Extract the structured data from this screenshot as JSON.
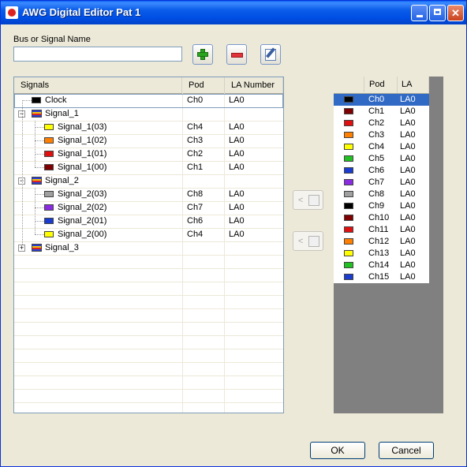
{
  "window": {
    "title": "AWG Digital Editor Pat 1",
    "min": "_",
    "max": "□",
    "close": "✕"
  },
  "form": {
    "bus_label": "Bus or Signal Name",
    "bus_value": "",
    "add_icon": "plus-icon",
    "remove_icon": "minus-icon",
    "edit_icon": "edit-icon"
  },
  "signals_table": {
    "headers": {
      "signals": "Signals",
      "pod": "Pod",
      "la": "LA Number"
    },
    "rows": [
      {
        "kind": "signal",
        "level": 0,
        "name": "Clock",
        "pod": "Ch0",
        "la": "LA0",
        "color": "#000000",
        "selected": true
      },
      {
        "kind": "bus",
        "level": 0,
        "expander": "−",
        "name": "Signal_1",
        "pod": "",
        "la": ""
      },
      {
        "kind": "signal",
        "level": 1,
        "name": "Signal_1(03)",
        "pod": "Ch4",
        "la": "LA0",
        "color": "#ffff00"
      },
      {
        "kind": "signal",
        "level": 1,
        "name": "Signal_1(02)",
        "pod": "Ch3",
        "la": "LA0",
        "color": "#ff7f00"
      },
      {
        "kind": "signal",
        "level": 1,
        "name": "Signal_1(01)",
        "pod": "Ch2",
        "la": "LA0",
        "color": "#e01010"
      },
      {
        "kind": "signal",
        "level": 1,
        "name": "Signal_1(00)",
        "pod": "Ch1",
        "la": "LA0",
        "color": "#7f0000"
      },
      {
        "kind": "bus",
        "level": 0,
        "expander": "−",
        "name": "Signal_2",
        "pod": "",
        "la": ""
      },
      {
        "kind": "signal",
        "level": 1,
        "name": "Signal_2(03)",
        "pod": "Ch8",
        "la": "LA0",
        "color": "#a0a0a0"
      },
      {
        "kind": "signal",
        "level": 1,
        "name": "Signal_2(02)",
        "pod": "Ch7",
        "la": "LA0",
        "color": "#8a2be2"
      },
      {
        "kind": "signal",
        "level": 1,
        "name": "Signal_2(01)",
        "pod": "Ch6",
        "la": "LA0",
        "color": "#1a3ccf"
      },
      {
        "kind": "signal",
        "level": 1,
        "name": "Signal_2(00)",
        "pod": "Ch4",
        "la": "LA0",
        "color": "#ffff00"
      },
      {
        "kind": "bus",
        "level": 0,
        "expander": "+",
        "name": "Signal_3",
        "pod": "",
        "la": ""
      }
    ]
  },
  "move_buttons": {
    "left_label": "<",
    "edit_label": "<",
    "left_icon": "assign-icon",
    "edit_icon": "edit-assign-icon"
  },
  "channels": {
    "headers": {
      "pod": "Pod",
      "la": "LA"
    },
    "rows": [
      {
        "ch": "Ch0",
        "la": "LA0",
        "color": "#000000",
        "selected": true
      },
      {
        "ch": "Ch1",
        "la": "LA0",
        "color": "#7f0000"
      },
      {
        "ch": "Ch2",
        "la": "LA0",
        "color": "#e01010"
      },
      {
        "ch": "Ch3",
        "la": "LA0",
        "color": "#ff7f00"
      },
      {
        "ch": "Ch4",
        "la": "LA0",
        "color": "#ffff00"
      },
      {
        "ch": "Ch5",
        "la": "LA0",
        "color": "#22c022"
      },
      {
        "ch": "Ch6",
        "la": "LA0",
        "color": "#1a3ccf"
      },
      {
        "ch": "Ch7",
        "la": "LA0",
        "color": "#8a2be2"
      },
      {
        "ch": "Ch8",
        "la": "LA0",
        "color": "#a0a0a0"
      },
      {
        "ch": "Ch9",
        "la": "LA0",
        "color": "#000000"
      },
      {
        "ch": "Ch10",
        "la": "LA0",
        "color": "#7f0000"
      },
      {
        "ch": "Ch11",
        "la": "LA0",
        "color": "#e01010"
      },
      {
        "ch": "Ch12",
        "la": "LA0",
        "color": "#ff7f00"
      },
      {
        "ch": "Ch13",
        "la": "LA0",
        "color": "#ffff00"
      },
      {
        "ch": "Ch14",
        "la": "LA0",
        "color": "#22c022"
      },
      {
        "ch": "Ch15",
        "la": "LA0",
        "color": "#1a3ccf"
      }
    ]
  },
  "buttons": {
    "ok": "OK",
    "cancel": "Cancel"
  }
}
